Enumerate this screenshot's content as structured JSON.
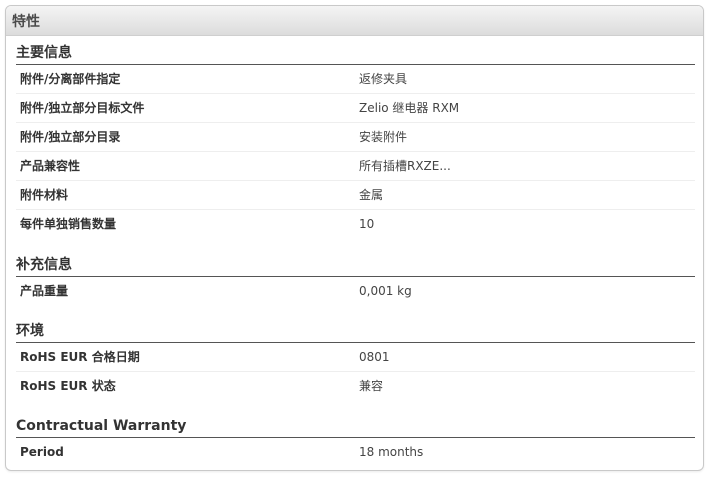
{
  "panel": {
    "title": "特性"
  },
  "sections": [
    {
      "title": "主要信息",
      "rows": [
        {
          "label": "附件/分离部件指定",
          "value": "返修夹具"
        },
        {
          "label": "附件/独立部分目标文件",
          "value": "Zelio 继电器 RXM"
        },
        {
          "label": "附件/独立部分目录",
          "value": "安装附件"
        },
        {
          "label": "产品兼容性",
          "value": "所有插槽RXZE..."
        },
        {
          "label": "附件材料",
          "value": "金属"
        },
        {
          "label": "每件单独销售数量",
          "value": "10"
        }
      ]
    },
    {
      "title": "补充信息",
      "rows": [
        {
          "label": "产品重量",
          "value": "0,001 kg"
        }
      ]
    },
    {
      "title": "环境",
      "rows": [
        {
          "label": "RoHS EUR 合格日期",
          "value": "0801"
        },
        {
          "label": "RoHS EUR 状态",
          "value": "兼容"
        }
      ]
    },
    {
      "title": "Contractual Warranty",
      "rows": [
        {
          "label": "Period",
          "value": "18 months"
        }
      ]
    }
  ]
}
